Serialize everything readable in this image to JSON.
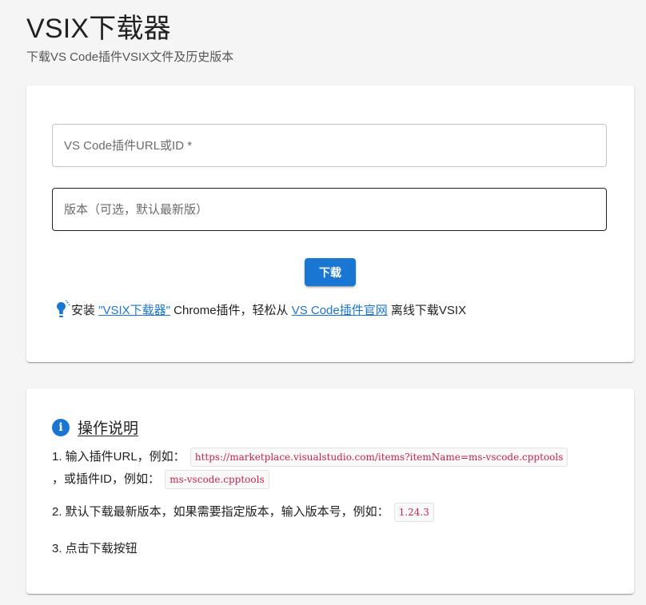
{
  "header": {
    "title": "VSIX下载器",
    "subtitle": "下载VS Code插件VSIX文件及历史版本"
  },
  "form": {
    "url_placeholder": "VS Code插件URL或ID *",
    "version_placeholder": "版本（可选，默认最新版）",
    "download_label": "下载"
  },
  "tip": {
    "prefix": "安装 ",
    "link1": "\"VSIX下载器\"",
    "middle": " Chrome插件，轻松从 ",
    "link2": "VS Code插件官网",
    "suffix": " 离线下载VSIX",
    "icon": "lightbulb-icon"
  },
  "help": {
    "title": "操作说明",
    "icon": "info-icon",
    "step1_prefix": "1. 输入插件URL，例如：",
    "step1_example_url": "https://marketplace.visualstudio.com/items?itemName=ms-vscode.cpptools",
    "step1_middle": "，或插件ID，例如：",
    "step1_example_id": "ms-vscode.cpptools",
    "step2_text": "2. 默认下载最新版本，如果需要指定版本，输入版本号，例如：",
    "step2_example": "1.24.3",
    "step3_text": "3. 点击下载按钮"
  },
  "colors": {
    "primary": "#1976d2",
    "code": "#c7254e",
    "background": "#f5f5f5"
  }
}
